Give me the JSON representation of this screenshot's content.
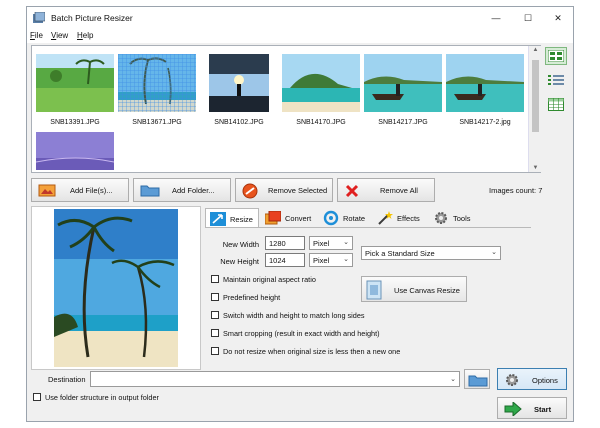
{
  "window": {
    "title": "Batch Picture Resizer",
    "min": "—",
    "max": "☐",
    "close": "✕"
  },
  "menu": [
    "File",
    "View",
    "Help"
  ],
  "thumbnails": [
    {
      "caption": "SNB13391.JPG"
    },
    {
      "caption": "SNB13671.JPG"
    },
    {
      "caption": "SNB14102.JPG"
    },
    {
      "caption": "SNB14170.JPG"
    },
    {
      "caption": "SNB14217.JPG"
    },
    {
      "caption": "SNB14217-2.jpg"
    }
  ],
  "toolbar": {
    "add_files": "Add File(s)...",
    "add_folder": "Add Folder...",
    "remove_selected": "Remove Selected",
    "remove_all": "Remove All"
  },
  "images_count": "Images count: 7",
  "tabs": [
    "Resize",
    "Convert",
    "Rotate",
    "Effects",
    "Tools"
  ],
  "resize": {
    "width_label": "New Width",
    "width_value": "1280",
    "width_unit": "Pixel",
    "height_label": "New Height",
    "height_value": "1024",
    "height_unit": "Pixel",
    "standard_size": "Pick a Standard Size",
    "options": [
      "Maintain original aspect ratio",
      "Predefined height",
      "Switch width and height to match long sides",
      "Smart cropping (result in exact width and height)",
      "Do not resize when original size is less then a new one"
    ],
    "canvas_button": "Use Canvas Resize"
  },
  "destination": {
    "label": "Destination",
    "value": ""
  },
  "folder_structure": "Use folder structure in output folder",
  "buttons": {
    "options": "Options",
    "start": "Start"
  }
}
